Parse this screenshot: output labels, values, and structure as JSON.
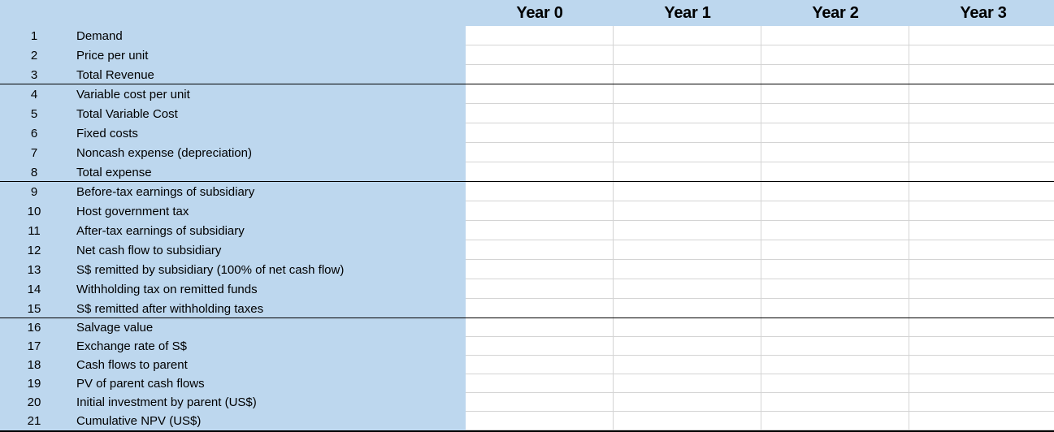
{
  "header": {
    "columns": [
      "Year 0",
      "Year 1",
      "Year 2",
      "Year 3"
    ]
  },
  "rows": [
    {
      "num": "1",
      "label": "Demand",
      "values": [
        "",
        "",
        "",
        ""
      ]
    },
    {
      "num": "2",
      "label": "Price per unit",
      "values": [
        "",
        "",
        "",
        ""
      ]
    },
    {
      "num": "3",
      "label": "Total Revenue",
      "values": [
        "",
        "",
        "",
        ""
      ]
    },
    {
      "num": "4",
      "label": "Variable cost per unit",
      "values": [
        "",
        "",
        "",
        ""
      ]
    },
    {
      "num": "5",
      "label": "Total Variable Cost",
      "values": [
        "",
        "",
        "",
        ""
      ]
    },
    {
      "num": "6",
      "label": "Fixed costs",
      "values": [
        "",
        "",
        "",
        ""
      ]
    },
    {
      "num": "7",
      "label": "Noncash expense (depreciation)",
      "values": [
        "",
        "",
        "",
        ""
      ]
    },
    {
      "num": "8",
      "label": "Total expense",
      "values": [
        "",
        "",
        "",
        ""
      ]
    },
    {
      "num": "9",
      "label": "Before-tax earnings of subsidiary",
      "values": [
        "",
        "",
        "",
        ""
      ]
    },
    {
      "num": "10",
      "label": "Host government tax",
      "values": [
        "",
        "",
        "",
        ""
      ]
    },
    {
      "num": "11",
      "label": "After-tax earnings of subsidiary",
      "values": [
        "",
        "",
        "",
        ""
      ]
    },
    {
      "num": "12",
      "label": "Net cash flow to subsidiary",
      "values": [
        "",
        "",
        "",
        ""
      ]
    },
    {
      "num": "13",
      "label": "S$ remitted by subsidiary (100% of net cash flow)",
      "values": [
        "",
        "",
        "",
        ""
      ]
    },
    {
      "num": "14",
      "label": "Withholding tax on remitted funds",
      "values": [
        "",
        "",
        "",
        ""
      ]
    },
    {
      "num": "15",
      "label": "S$ remitted after withholding taxes",
      "values": [
        "",
        "",
        "",
        ""
      ]
    },
    {
      "num": "16",
      "label": "Salvage value",
      "values": [
        "",
        "",
        "",
        ""
      ]
    },
    {
      "num": "17",
      "label": "Exchange rate of S$",
      "values": [
        "",
        "",
        "",
        ""
      ]
    },
    {
      "num": "18",
      "label": "Cash flows to parent",
      "values": [
        "",
        "",
        "",
        ""
      ]
    },
    {
      "num": "19",
      "label": "PV of parent cash flows",
      "values": [
        "",
        "",
        "",
        ""
      ]
    },
    {
      "num": "20",
      "label": "Initial investment by parent (US$)",
      "values": [
        "",
        "",
        "",
        ""
      ]
    },
    {
      "num": "21",
      "label": "Cumulative NPV (US$)",
      "values": [
        "",
        "",
        "",
        ""
      ]
    }
  ],
  "colors": {
    "label_background": "#bdd7ee",
    "cell_background": "#ffffff",
    "gridline": "#d4d4d4",
    "separator": "#000000"
  }
}
